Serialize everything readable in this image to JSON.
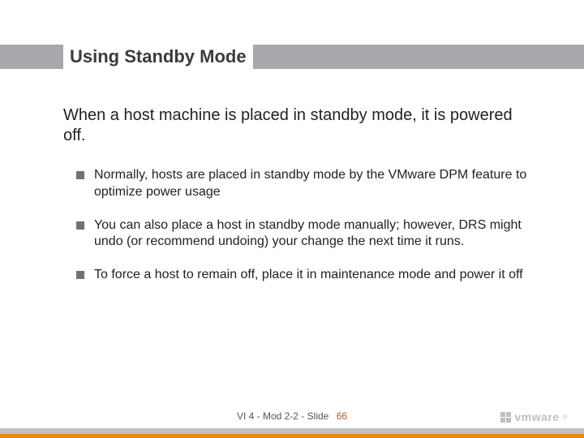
{
  "title": "Using Standby Mode",
  "lead": "When a host machine is placed in standby mode, it is powered off.",
  "bullets": [
    "Normally, hosts are placed in standby mode by the VMware DPM feature to optimize power usage",
    "You can also place a host in standby mode manually; however, DRS might undo (or recommend undoing) your change the next time it runs.",
    "To force a host to remain off, place it in maintenance mode and power it off"
  ],
  "footer": {
    "module": "VI 4 - Mod 2-2 - Slide",
    "page": "66"
  },
  "brand": "vmware"
}
